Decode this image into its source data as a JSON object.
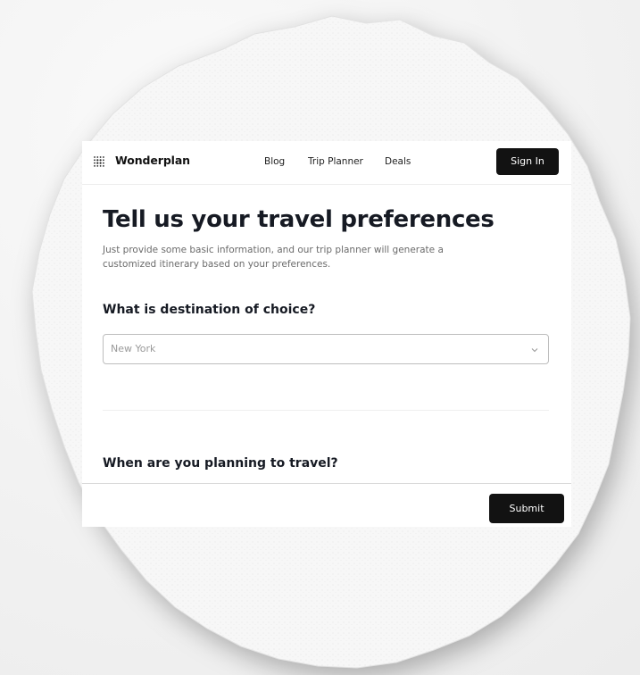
{
  "brand": {
    "name": "Wonderplan",
    "icon": "dot-grid-icon"
  },
  "nav": {
    "links": [
      "Blog",
      "Trip Planner",
      "Deals"
    ],
    "signin_label": "Sign In"
  },
  "form": {
    "title": "Tell us your travel preferences",
    "subtitle": "Just provide some basic information, and our trip planner will generate a customized itinerary based on your preferences.",
    "destination": {
      "question": "What is destination of choice?",
      "selected": "New York",
      "icon": "chevron-down-icon"
    },
    "travel_date": {
      "question": "When are you planning to travel?"
    },
    "submit_label": "Submit"
  },
  "colors": {
    "button_bg": "#121212",
    "title_text": "#161a23",
    "muted_text": "#6b6b6b"
  }
}
